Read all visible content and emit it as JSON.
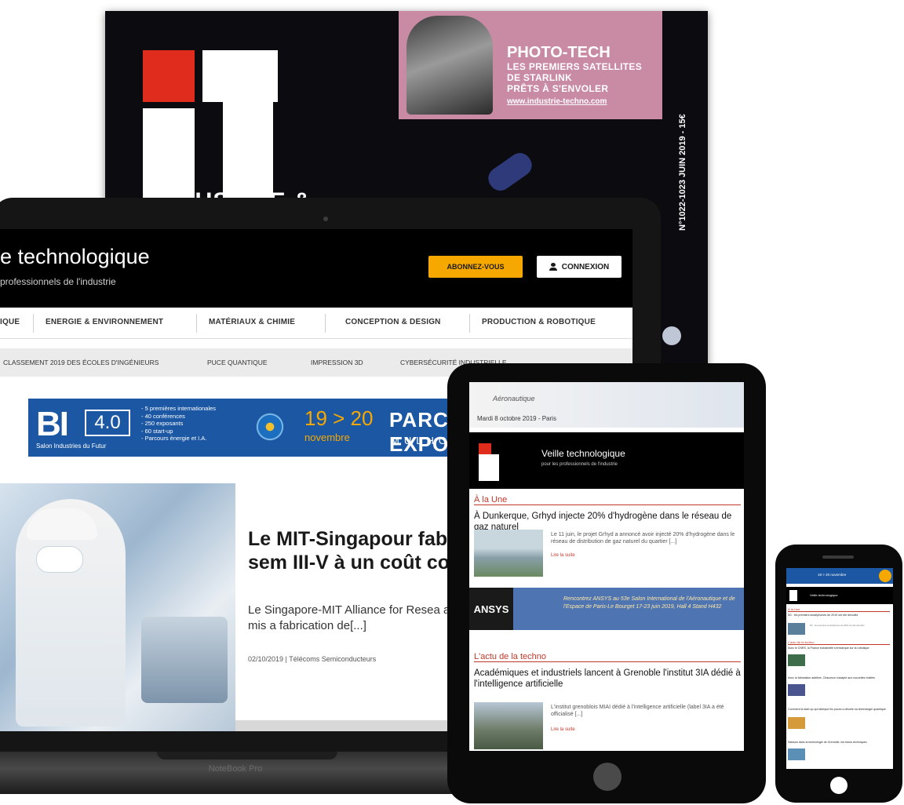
{
  "magazine": {
    "logo_text": "INDUSTRIE &",
    "photo_tech_title": "PHOTO-TECH",
    "photo_tech_lines": [
      "LES PREMIERS SATELLITES",
      "DE STARLINK",
      "PRÊTS À S'ENVOLER"
    ],
    "photo_tech_url": "www.industrie-techno.com",
    "spine_text": "N°1022-1023 JUIN 2019 - 15€"
  },
  "laptop": {
    "brand": "NoteBook Pro",
    "header": {
      "title": "e technologique",
      "tagline": "professionnels de l'industrie",
      "subscribe_label": "ABONNEZ-VOUS",
      "login_label": "CONNEXION"
    },
    "nav": [
      "IQUE",
      "ENERGIE & ENVIRONNEMENT",
      "MATÉRIAUX & CHIMIE",
      "CONCEPTION & DESIGN",
      "PRODUCTION & ROBOTIQUE"
    ],
    "sub_nav": [
      "CLASSEMENT 2019 DES ÉCOLES D'INGÉNIEURS",
      "PUCE QUANTIQUE",
      "IMPRESSION 3D",
      "CYBERSÉCURITÉ INDUSTRIELLE"
    ],
    "banner": {
      "logo": "BI",
      "logo_num": "4.0",
      "salon": "Salon Industries du Futur",
      "features": [
        "- 5 premières internationales",
        "- 40 conférences",
        "- 250 exposants",
        "- 60 start-up",
        "- Parcours énergie et I.A."
      ],
      "dates": "19 > 20",
      "month": "novembre",
      "venue": "PARC EXPO",
      "city": "MULHOU"
    },
    "featured": {
      "title": "Le MIT-Singapour fab puces silicium – sem III-V à un coût compé",
      "description": "Le Singapore-MIT Alliance for Resea annoncé ce 30 septembre avoir mis a fabrication de[...]",
      "meta": "02/10/2019 | Télécoms  Semiconducteurs"
    }
  },
  "tablet": {
    "ad_title": "Aéronautique",
    "ad_date": "Mardi 8 octobre 2019 - Paris",
    "header_title": "Veille technologique",
    "header_sub": "pour les professionnels de l'industrie",
    "section_1": "À la Une",
    "article_1_title": "À Dunkerque, Grhyd injecte 20% d'hydrogène dans le réseau de gaz naturel",
    "article_1_text": "Le 11 juin, le projet Grhyd a annoncé avoir injecté 20% d'hydrogène dans le réseau de distribution de gaz naturel du quartier [...]",
    "read_more": "Lire la suite",
    "ansys_logo": "ANSYS",
    "ansys_text": "Rencontrez ANSYS au 53e Salon International de l'Aéronautique et de l'Espace de Paris-Le Bourget 17-23 juin 2019, Hall 4 Stand H432",
    "section_2": "L'actu de la techno",
    "article_2_title": "Académiques et industriels lancent à Grenoble l'institut 3IA dédié à l'intelligence artificielle",
    "article_2_text": "L'institut grenoblois MIAI dédié à l'intelligence artificielle (label 3IA a été officialisé [...]"
  },
  "phone": {
    "ad_text": "19 > 20 novembre",
    "header_title": "Veille technologique",
    "section_1": "À la Une",
    "line_1": "5G : les premiers smartphones de 2019 ont été dévoilés",
    "section_2": "L'actu de la techno",
    "line_2": "Avec le CNRS, la France industrielle s'embarque sur la robotique",
    "line_3": "Avec la fabrication additive, Chausson s'adapte aux nouvelles réalités",
    "line_4": "Comment la start-up qui fabrique les puces a dévoilé sa technologie quantique",
    "line_5": "Saisson dans la technologie de Grenoble, les futurs techniques"
  }
}
